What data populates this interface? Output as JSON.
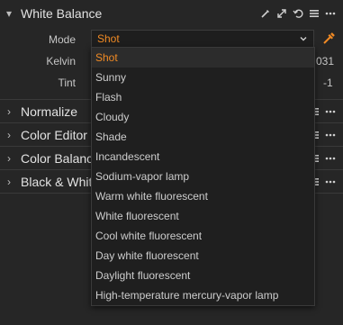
{
  "white_balance": {
    "title": "White Balance",
    "expand_glyph": "▾",
    "tool_icons": [
      "picker-icon",
      "expand-icon",
      "reset-icon",
      "menu-icon",
      "more-icon"
    ],
    "mode": {
      "label": "Mode",
      "value": "Shot"
    },
    "kelvin": {
      "label": "Kelvin",
      "value": "031"
    },
    "tint": {
      "label": "Tint",
      "value": "-1"
    }
  },
  "panels": [
    {
      "title": "Normalize",
      "glyph": "›"
    },
    {
      "title": "Color Editor",
      "glyph": "›"
    },
    {
      "title": "Color Balance",
      "glyph": "›"
    },
    {
      "title": "Black & White",
      "glyph": "›"
    }
  ],
  "dropdown": {
    "selected": "Shot",
    "options": [
      "Shot",
      "Sunny",
      "Flash",
      "Cloudy",
      "Shade",
      "Incandescent",
      "Sodium-vapor lamp",
      "Warm white fluorescent",
      "White fluorescent",
      "Cool white fluorescent",
      "Day white fluorescent",
      "Daylight fluorescent",
      "High-temperature mercury-vapor lamp"
    ]
  },
  "colors": {
    "accent": "#f08a24",
    "background": "#262626",
    "menu_background": "#1f1f1f"
  }
}
